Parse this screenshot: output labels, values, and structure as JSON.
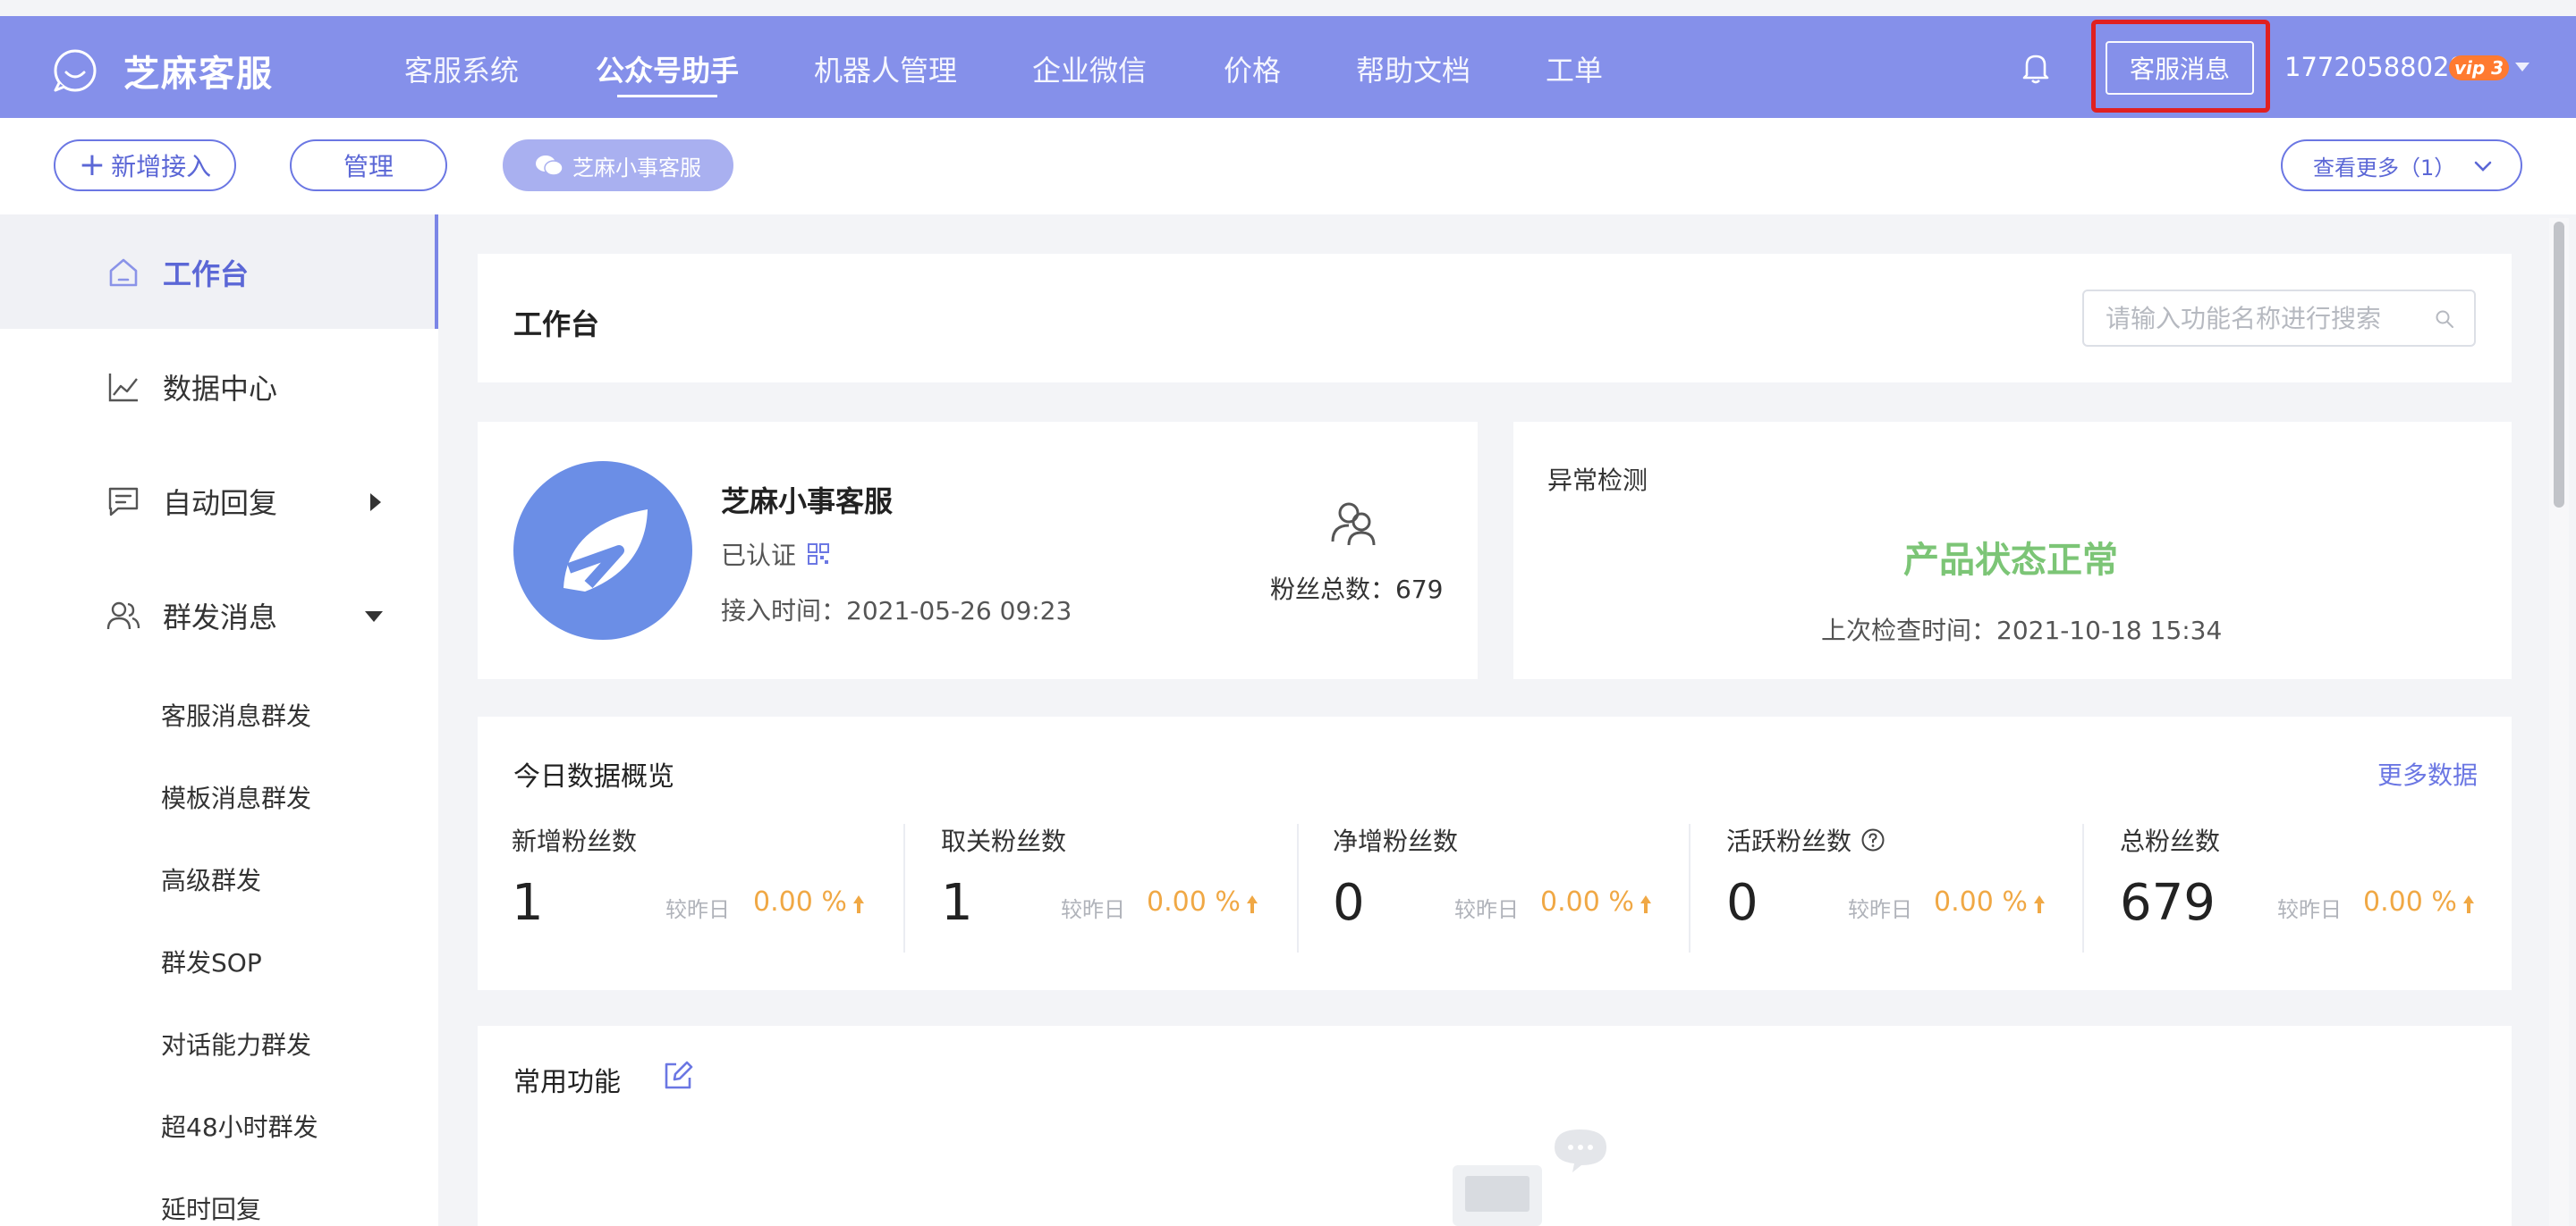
{
  "navbar": {
    "logo_text": "芝麻客服",
    "items": [
      "客服系统",
      "公众号助手",
      "机器人管理",
      "企业微信",
      "价格",
      "帮助文档",
      "工单"
    ],
    "active_index": 1,
    "cs_message_label": "客服消息",
    "phone": "17720588029",
    "vip_label": "vip 3"
  },
  "subbar": {
    "add_label": "新增接入",
    "manage_label": "管理",
    "account_pill_label": "芝麻小事客服",
    "more_label": "查看更多（1）"
  },
  "sidebar": {
    "items": [
      {
        "label": "工作台",
        "icon": "home-icon"
      },
      {
        "label": "数据中心",
        "icon": "chart-icon"
      },
      {
        "label": "自动回复",
        "icon": "message-icon"
      },
      {
        "label": "群发消息",
        "icon": "users-icon"
      }
    ],
    "sub_items": [
      "客服消息群发",
      "模板消息群发",
      "高级群发",
      "群发SOP",
      "对话能力群发",
      "超48小时群发",
      "延时回复"
    ]
  },
  "workbench": {
    "title": "工作台",
    "search_placeholder": "请输入功能名称进行搜索"
  },
  "account": {
    "name": "芝麻小事客服",
    "verified": "已认证",
    "access_time": "接入时间：2021-05-26 09:23",
    "fans_total": "粉丝总数：679"
  },
  "anomaly": {
    "title": "异常检测",
    "status": "产品状态正常",
    "last_check": "上次检查时间：2021-10-18 15:34"
  },
  "overview": {
    "title": "今日数据概览",
    "more_label": "更多数据",
    "compare_label": "较昨日",
    "metrics": [
      {
        "label": "新增粉丝数",
        "value": "1",
        "pct": "0.00 %"
      },
      {
        "label": "取关粉丝数",
        "value": "1",
        "pct": "0.00 %"
      },
      {
        "label": "净增粉丝数",
        "value": "0",
        "pct": "0.00 %"
      },
      {
        "label": "活跃粉丝数",
        "value": "0",
        "pct": "0.00 %"
      },
      {
        "label": "总粉丝数",
        "value": "679",
        "pct": "0.00 %"
      }
    ]
  },
  "common": {
    "title": "常用功能"
  },
  "colors": {
    "navbar": "#8590ea",
    "accent": "#5b67d6",
    "status_ok": "#7cc576",
    "pct": "#f0a845",
    "highlight_box": "#e02020"
  }
}
